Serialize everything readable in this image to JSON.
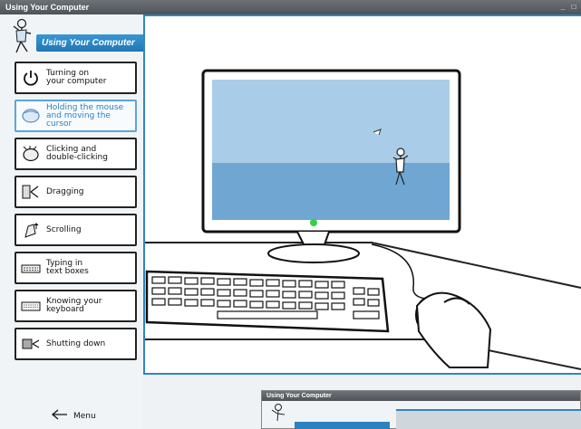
{
  "window": {
    "title": "Using Your Computer",
    "controls": [
      "_",
      "□"
    ]
  },
  "sidebar": {
    "header_label": "Using Your Computer",
    "items": [
      {
        "label": "Turning on\nyour computer",
        "icon": "power-icon",
        "active": false
      },
      {
        "label": "Holding the mouse\nand moving the cursor",
        "icon": "mouse-icon",
        "active": true
      },
      {
        "label": "Clicking and\ndouble-clicking",
        "icon": "mouse-click-icon",
        "active": false
      },
      {
        "label": "Dragging",
        "icon": "drag-icon",
        "active": false
      },
      {
        "label": "Scrolling",
        "icon": "scroll-icon",
        "active": false
      },
      {
        "label": "Typing in\ntext boxes",
        "icon": "typing-icon",
        "active": false
      },
      {
        "label": "Knowing your\nkeyboard",
        "icon": "keyboard-icon",
        "active": false
      },
      {
        "label": "Shutting down",
        "icon": "shutdown-icon",
        "active": false
      }
    ],
    "menu_label": "Menu"
  },
  "subwindow": {
    "title": "Using Your Computer"
  },
  "colors": {
    "accent": "#2f86c2",
    "screen_sky": "#a9cde8",
    "screen_ground": "#6fa6d2",
    "power_led": "#2fd33c"
  }
}
